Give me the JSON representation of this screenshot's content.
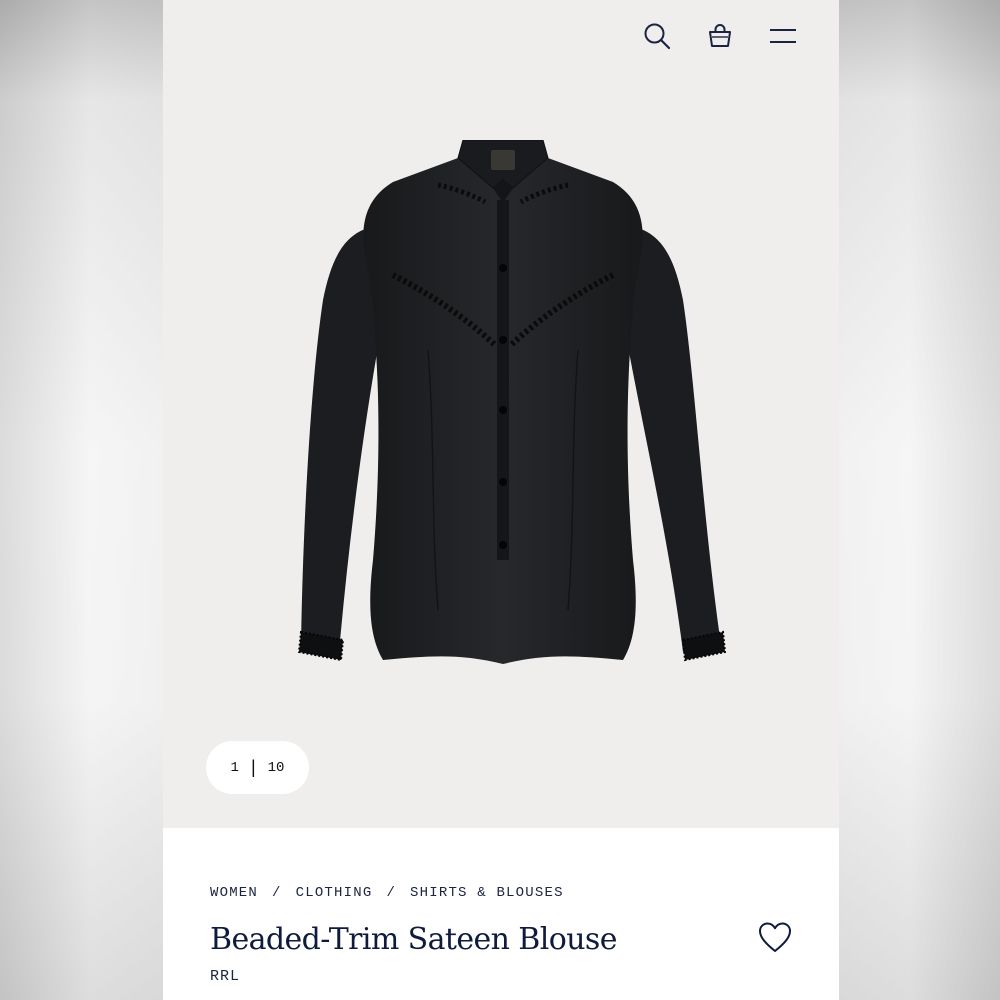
{
  "header": {
    "icons": [
      "search-icon",
      "shopping-bag-icon",
      "menu-icon"
    ]
  },
  "gallery": {
    "current": "1",
    "separator": "|",
    "total": "10"
  },
  "breadcrumb": {
    "items": [
      "WOMEN",
      "CLOTHING",
      "SHIRTS & BLOUSES"
    ],
    "separator": "/"
  },
  "product": {
    "title": "Beaded-Trim Sateen Blouse",
    "brand": "RRL",
    "color": "black",
    "wishlist_icon": "heart-icon"
  },
  "colors": {
    "hero_background": "#efeeed",
    "text_navy": "#0f1b3d",
    "garment": "#1f2124"
  }
}
